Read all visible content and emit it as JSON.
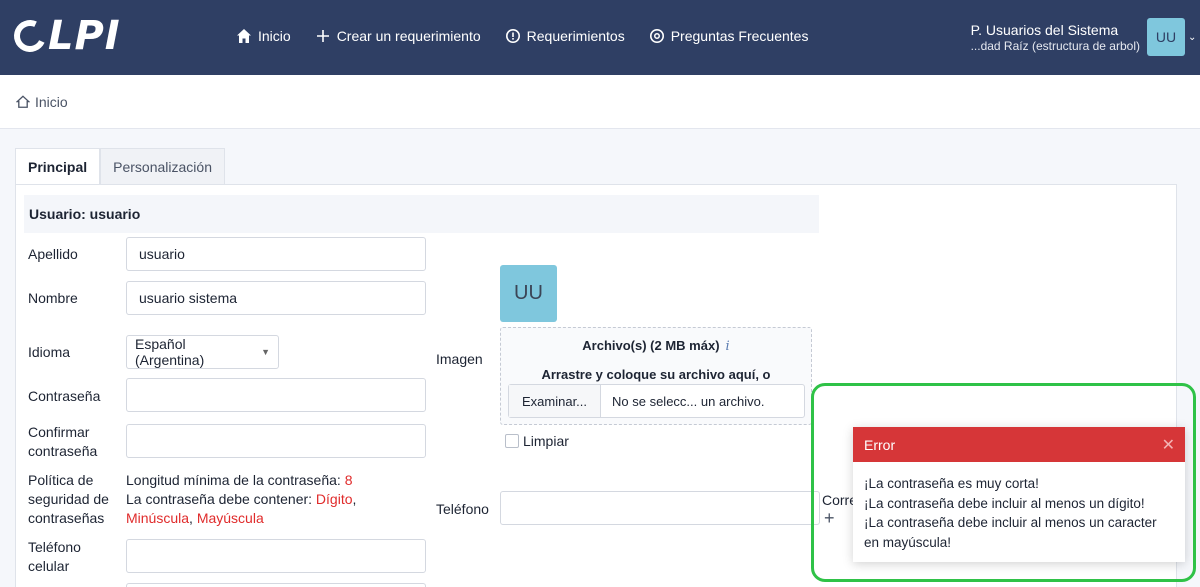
{
  "navbar": {
    "logo_text": "LPI",
    "menu": [
      {
        "label": "Inicio",
        "icon": "home-icon"
      },
      {
        "label": "Crear un requerimiento",
        "icon": "plus-icon"
      },
      {
        "label": "Requerimientos",
        "icon": "alert-circle-icon"
      },
      {
        "label": "Preguntas Frecuentes",
        "icon": "lifebuoy-icon"
      }
    ],
    "profile": "P. Usuarios del Sistema",
    "entity": "...dad Raíz (estructura de arbol)",
    "avatar_initials": "UU"
  },
  "breadcrumb": {
    "label": "Inicio"
  },
  "tabs": [
    {
      "label": "Principal"
    },
    {
      "label": "Personalización"
    }
  ],
  "form": {
    "title": "Usuario: usuario",
    "apellido_label": "Apellido",
    "apellido_value": "usuario",
    "nombre_label": "Nombre",
    "nombre_value": "usuario sistema",
    "idioma_label": "Idioma",
    "idioma_value": "Español (Argentina)",
    "contrasena_label": "Contraseña",
    "confirmar_label_1": "Confirmar",
    "confirmar_label_2": "contraseña",
    "politica_label_1": "Política de",
    "politica_label_2": "seguridad de",
    "politica_label_3": "contraseñas",
    "policy_min_length_text": "Longitud mínima de la contraseña:",
    "policy_min_length_value": "8",
    "policy_contain_text": "La contraseña debe contener:",
    "policy_digit": "Dígito",
    "policy_lower": "Minúscula",
    "policy_upper": "Mayúscula",
    "celular_label_1": "Teléfono",
    "celular_label_2": "celular",
    "imagen_label": "Imagen",
    "image_avatar": "UU",
    "dropzone_title": "Archivo(s) (2 MB máx)",
    "dropzone_info": "i",
    "dropzone_drag": "Arrastre y coloque su archivo aquí, o",
    "file_button": "Examinar...",
    "file_text": "No se selecc... un archivo.",
    "limpiar_label": "Limpiar",
    "telefono_label": "Teléfono",
    "correo_label": "Corre"
  },
  "toast": {
    "title": "Error",
    "lines": [
      "¡La contraseña es muy corta!",
      "¡La contraseña debe incluir al menos un dígito!",
      "¡La contraseña debe incluir al menos un caracter",
      "en mayúscula!"
    ]
  },
  "colors": {
    "navbar": "#2f3f64",
    "avatar": "#7fc7dd",
    "error_red": "#d63638",
    "highlight_green": "#2fc247"
  }
}
